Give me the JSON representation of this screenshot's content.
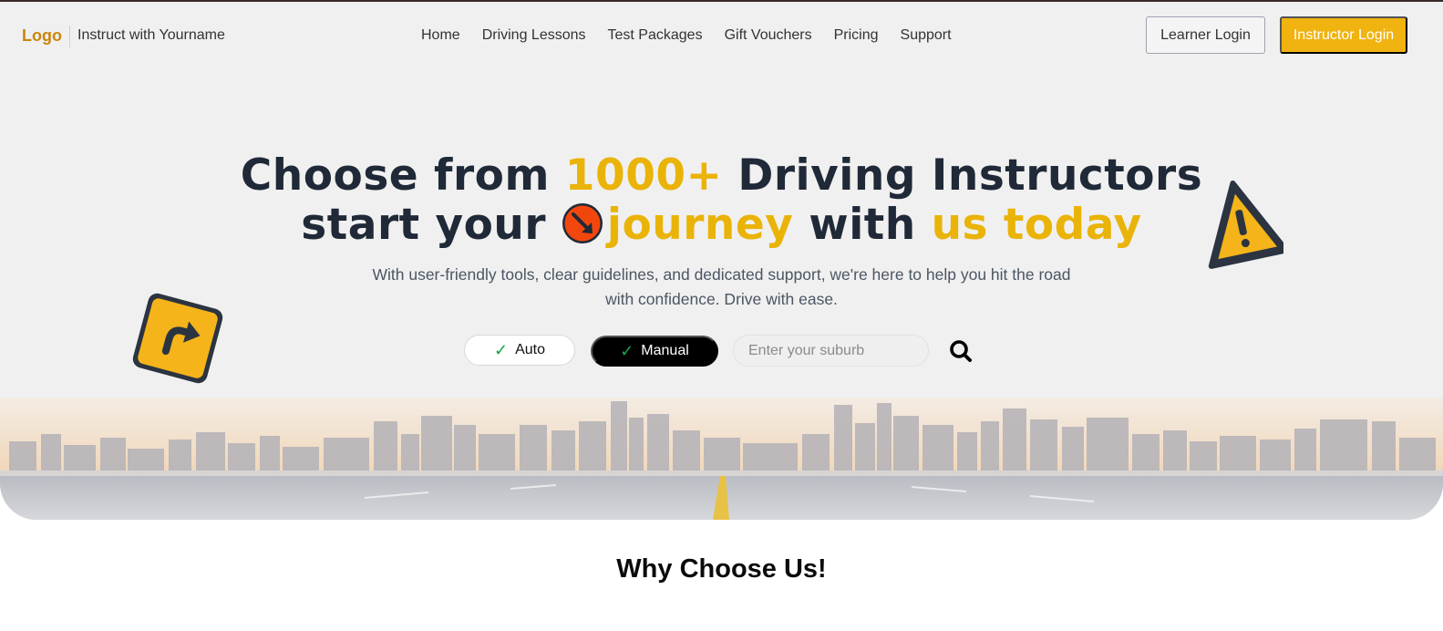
{
  "header": {
    "logo": "Logo",
    "brand_name": "Instruct with Yourname",
    "nav": [
      {
        "label": "Home"
      },
      {
        "label": "Driving Lessons"
      },
      {
        "label": "Test Packages"
      },
      {
        "label": "Gift Vouchers"
      },
      {
        "label": "Pricing"
      },
      {
        "label": "Support"
      }
    ],
    "learner_login": "Learner Login",
    "instructor_login": "Instructor Login"
  },
  "hero": {
    "line1_a": "Choose from ",
    "line1_highlight": "1000+",
    "line1_b": " Driving Instructors",
    "line2_a": "start your ",
    "line2_highlight1": "journey",
    "line2_b": " with ",
    "line2_highlight2": "us today",
    "subtext": "With user-friendly tools, clear guidelines, and dedicated support, we're here to help you hit the road with confidence. Drive with ease."
  },
  "search": {
    "transmission_options": [
      {
        "label": "Auto",
        "icon": "check-icon",
        "selected": false
      },
      {
        "label": "Manual",
        "icon": "check-icon",
        "selected": true
      }
    ],
    "suburb_placeholder": "Enter your suburb",
    "search_icon": "search-icon"
  },
  "decor": {
    "left_sign": "turn-right-sign-icon",
    "right_sign": "warning-sign-icon",
    "inline_sign": "keep-left-sign-icon"
  },
  "section": {
    "why_title": "Why Choose Us!"
  },
  "colors": {
    "accent": "#eab308",
    "logo": "#c8860d",
    "heading": "#1f2937",
    "hero_bg": "#f0f0f0"
  }
}
